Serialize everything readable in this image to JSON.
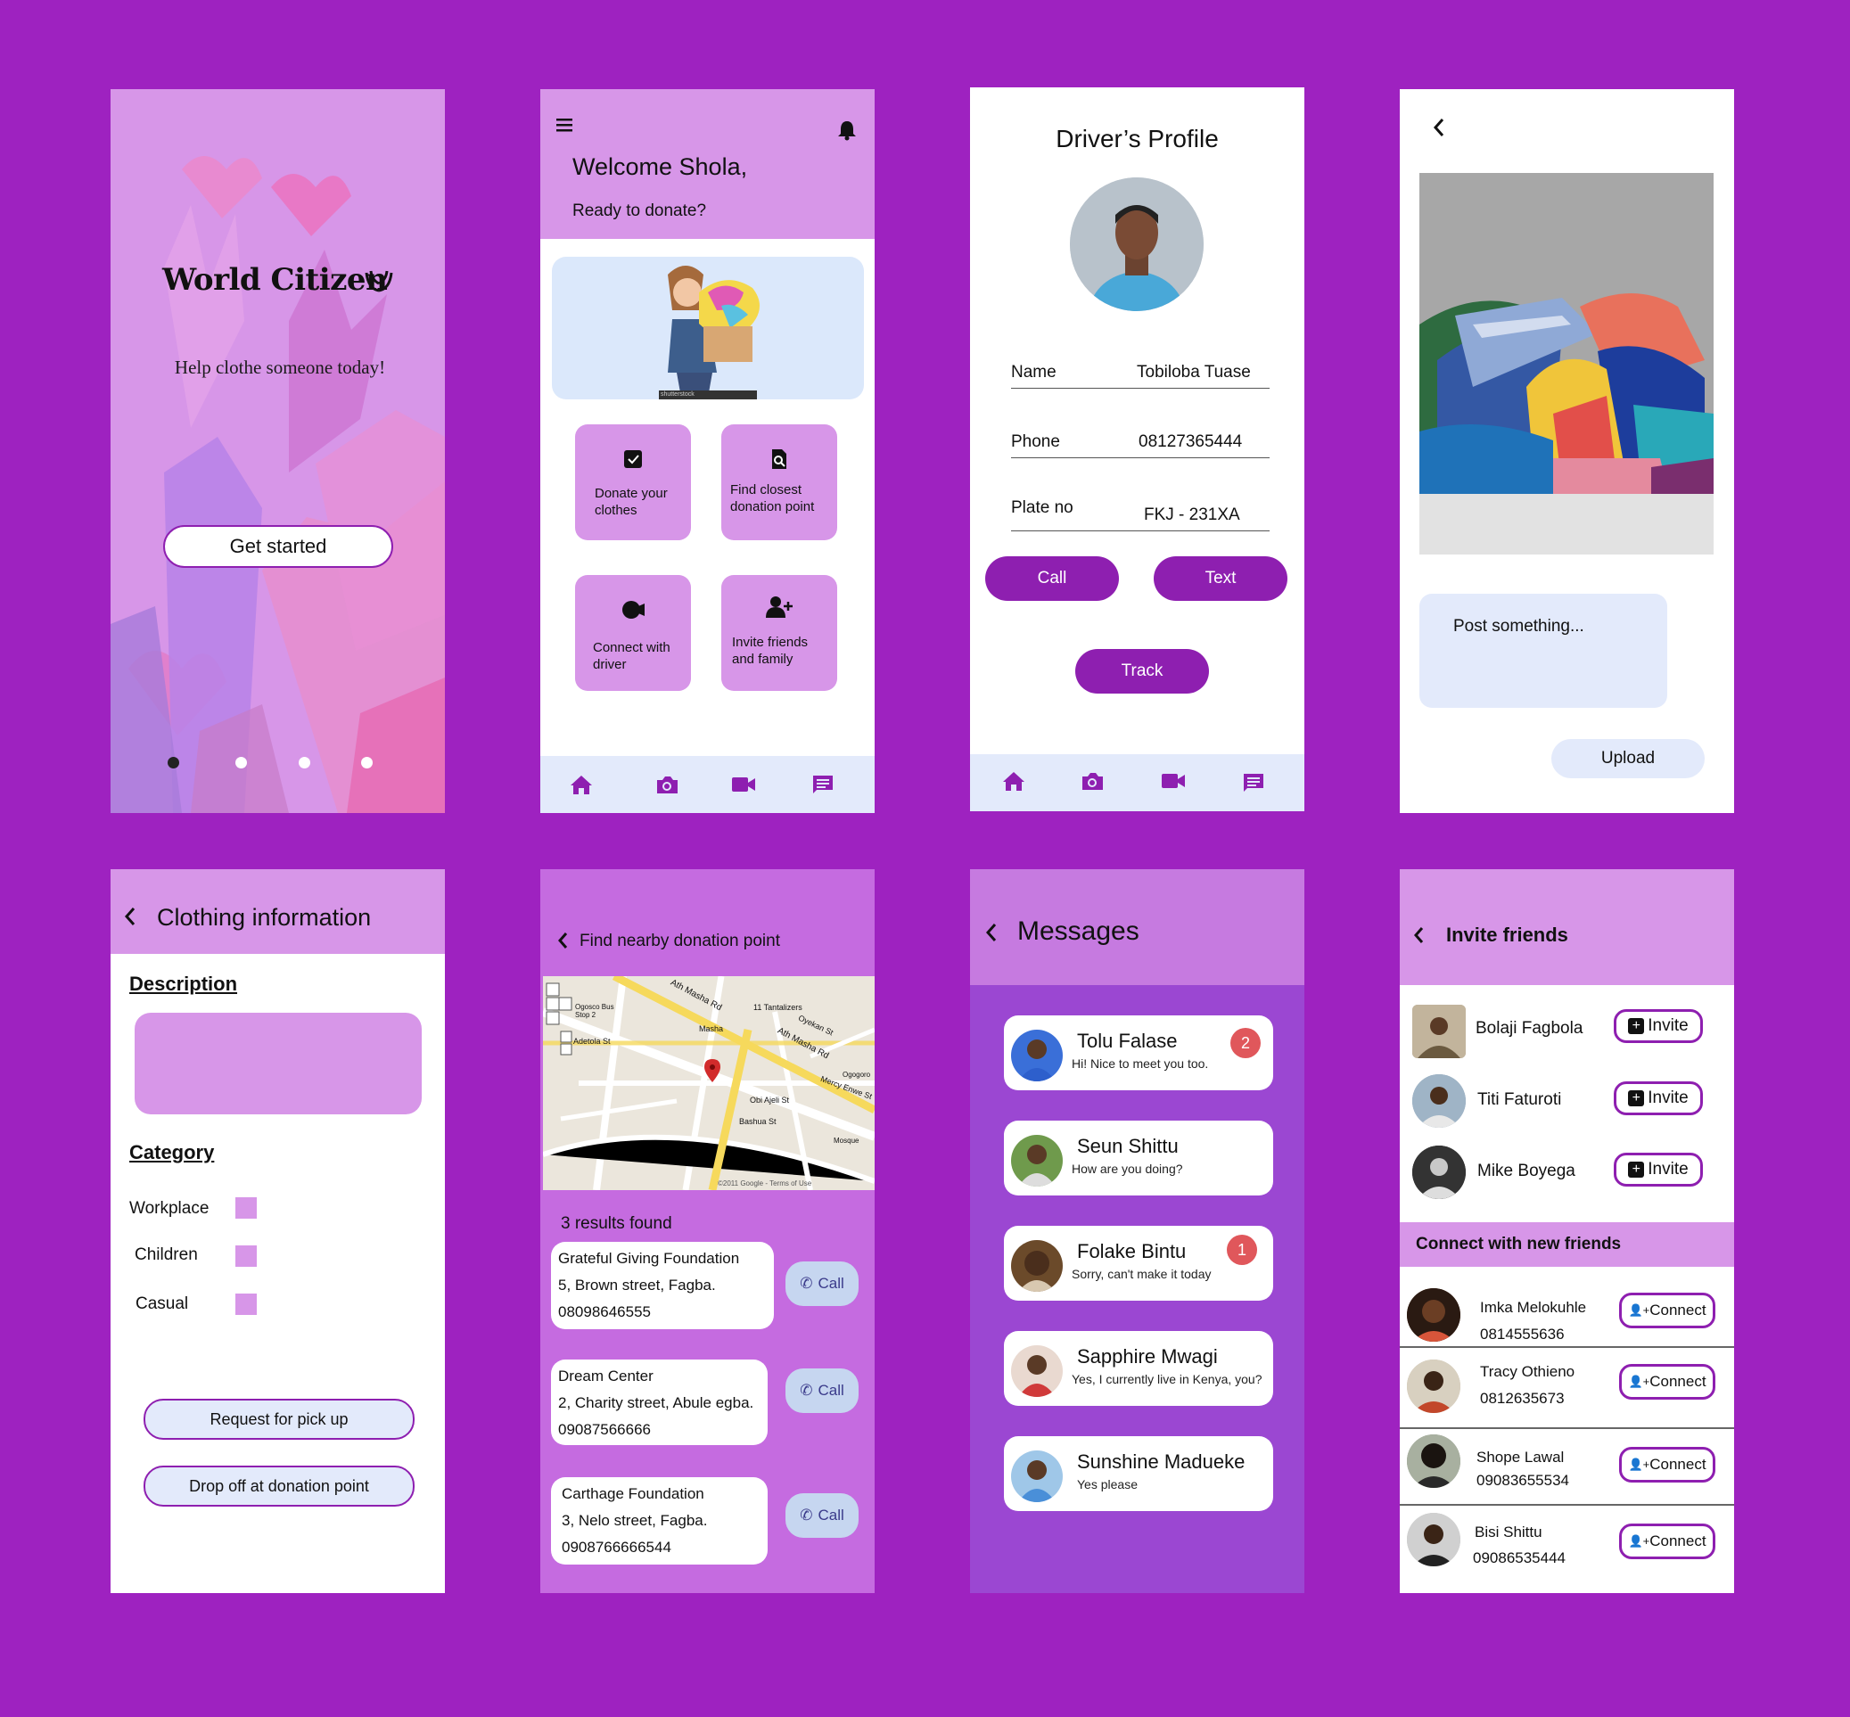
{
  "onboarding": {
    "logo": "World Citizen",
    "tagline": "Help clothe someone today!",
    "cta": "Get started"
  },
  "home": {
    "greeting": "Welcome Shola,",
    "subtitle": "Ready to donate?",
    "banner_caption": "shutterstock",
    "tiles": [
      {
        "label": "Donate your clothes"
      },
      {
        "label": "Find closest donation point"
      },
      {
        "label": "Connect with driver"
      },
      {
        "label": "Invite friends and family"
      }
    ]
  },
  "driver": {
    "title": "Driver’s Profile",
    "fields": [
      {
        "key": "Name",
        "value": "Tobiloba Tuase"
      },
      {
        "key": "Phone",
        "value": "08127365444"
      },
      {
        "key": "Plate no",
        "value": "FKJ - 231XA"
      }
    ],
    "call": "Call",
    "text": "Text",
    "track": "Track"
  },
  "post": {
    "placeholder": "Post something...",
    "upload": "Upload"
  },
  "clothing": {
    "title": "Clothing information",
    "description_label": "Description",
    "category_label": "Category",
    "categories": [
      "Workplace",
      "Children",
      "Casual"
    ],
    "request_pickup": "Request for pick up",
    "drop_off": "Drop off at donation point"
  },
  "nearby": {
    "title": "Find nearby donation point",
    "map_labels": {
      "street1": "Ath Masha Rd",
      "street2": "Ath Masha Rd",
      "street3": "Masha",
      "street4": "Oyekan St",
      "street5": "Bashua St",
      "street6": "Obi Ajeli St",
      "street7": "Mercy Enwe St",
      "street8": "Ogosco Bus Stop 2",
      "street9": "Adetola St",
      "street10": "11 Tantalizers",
      "street11": "Ogogoro",
      "street12": "Mosque",
      "copyright": "©2011 Google - Terms of Use"
    },
    "results_count": "3 results found",
    "results": [
      {
        "name": "Grateful Giving Foundation",
        "address": "5, Brown street, Fagba.",
        "phone": "08098646555"
      },
      {
        "name": "Dream Center",
        "address": "2, Charity street, Abule egba.",
        "phone": "09087566666"
      },
      {
        "name": "Carthage Foundation",
        "address": "3, Nelo street, Fagba.",
        "phone": "0908766666544"
      }
    ],
    "call_label": "Call"
  },
  "messages": {
    "title": "Messages",
    "items": [
      {
        "name": "Tolu Falase",
        "text": "Hi! Nice to meet you too.",
        "badge": "2",
        "color": "#3a6fd8"
      },
      {
        "name": "Seun Shittu",
        "text": "How are you doing?",
        "badge": "",
        "color": "#5b8a3c"
      },
      {
        "name": "Folake Bintu",
        "text": "Sorry, can't make it today",
        "badge": "1",
        "color": "#6b4a2a"
      },
      {
        "name": "Sapphire Mwagi",
        "text": "Yes, I currently live in Kenya, you?",
        "badge": "",
        "color": "#c9403f"
      },
      {
        "name": "Sunshine Madueke",
        "text": "Yes please",
        "badge": "",
        "color": "#4a8fd8"
      }
    ]
  },
  "invite": {
    "title": "Invite friends",
    "invite_label": "Invite",
    "friends": [
      {
        "name": "Bolaji Fagbola"
      },
      {
        "name": "Titi Faturoti"
      },
      {
        "name": "Mike Boyega"
      }
    ],
    "connect_header": "Connect with new friends",
    "connect_label": "Connect",
    "new_friends": [
      {
        "name": "Imka Melokuhle",
        "phone": "0814555636"
      },
      {
        "name": "Tracy Othieno",
        "phone": "0812635673"
      },
      {
        "name": "Shope Lawal",
        "phone": "09083655534"
      },
      {
        "name": "Bisi Shittu",
        "phone": "09086535444"
      }
    ]
  },
  "colors": {
    "brand": "#8e1fb0",
    "background": "#9e22c0",
    "lilac": "#d796e8",
    "pale_blue": "#e3eafb"
  }
}
